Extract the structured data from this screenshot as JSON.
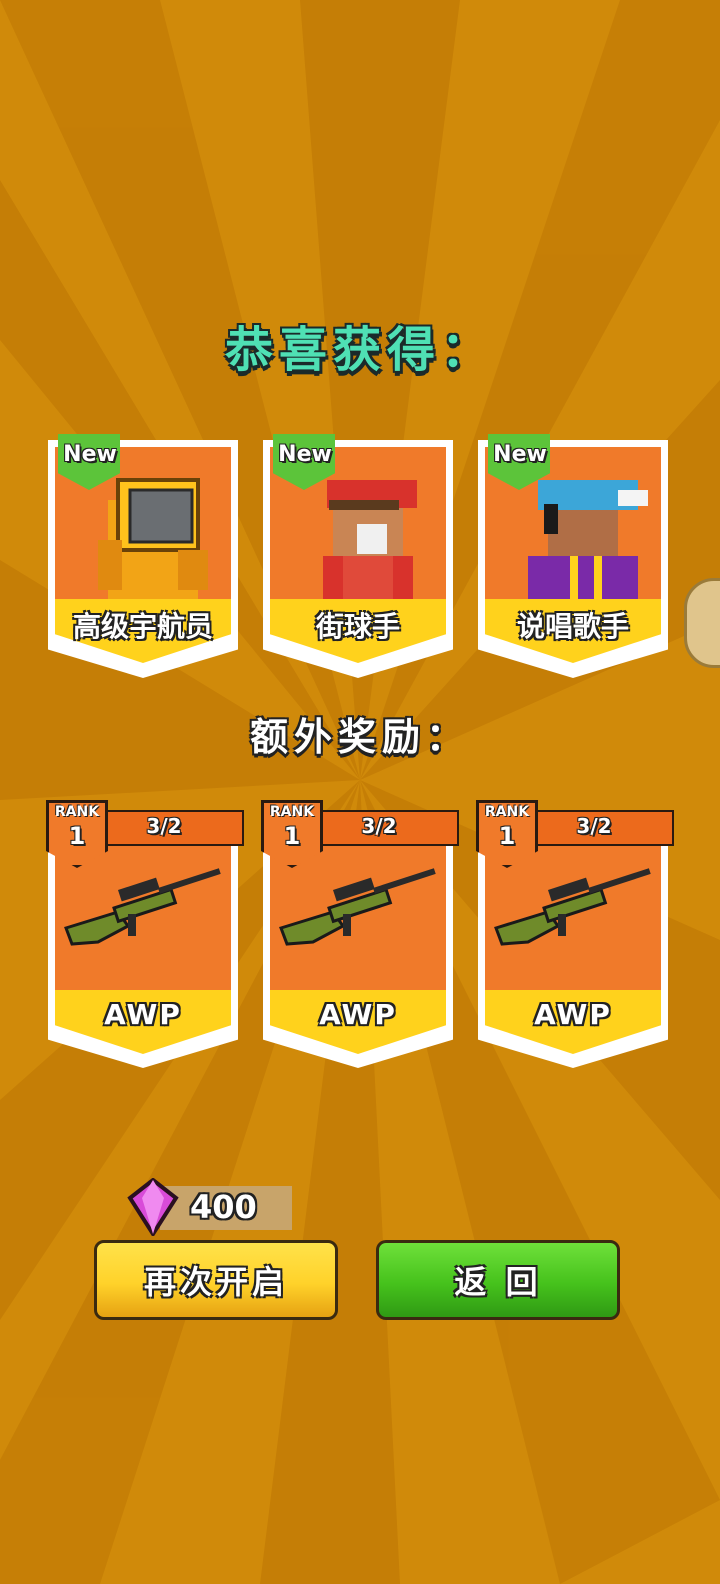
{
  "colors": {
    "background": "#d08a0a",
    "title": "#4fe0b4",
    "card_orange": "#f07a2a",
    "card_yellow": "#ffd21c",
    "new_badge": "#5cc43a",
    "button_yellow": "#ffd22a",
    "button_green": "#46c21c",
    "gem": "#d84bd8"
  },
  "title": "恭喜获得：",
  "characters": [
    {
      "name": "高级宇航员",
      "badge": "New",
      "icon": "astronaut-icon"
    },
    {
      "name": "街球手",
      "badge": "New",
      "icon": "streetballer-icon"
    },
    {
      "name": "说唱歌手",
      "badge": "New",
      "icon": "rapper-icon"
    }
  ],
  "extra_title": "额外奖励：",
  "weapons": [
    {
      "name": "AWP",
      "rank_label": "RANK",
      "rank": "1",
      "progress": "3/2",
      "icon": "sniper-rifle-icon"
    },
    {
      "name": "AWP",
      "rank_label": "RANK",
      "rank": "1",
      "progress": "3/2",
      "icon": "sniper-rifle-icon"
    },
    {
      "name": "AWP",
      "rank_label": "RANK",
      "rank": "1",
      "progress": "3/2",
      "icon": "sniper-rifle-icon"
    }
  ],
  "gems": {
    "count": "400",
    "icon": "gem-icon"
  },
  "buttons": {
    "again": "再次开启",
    "back": "返 回"
  },
  "side_icon": "chat-icon"
}
